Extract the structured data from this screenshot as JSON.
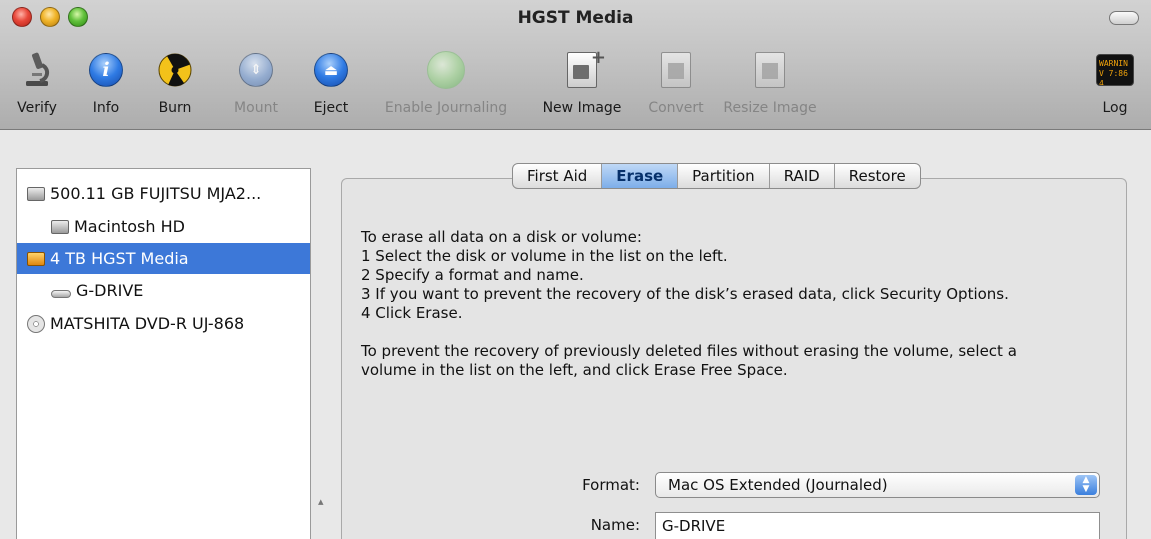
{
  "window": {
    "title": "HGST Media"
  },
  "toolbar": [
    {
      "label": "Verify",
      "icon": "microscope-icon",
      "enabled": true
    },
    {
      "label": "Info",
      "icon": "info-icon",
      "enabled": true
    },
    {
      "label": "Burn",
      "icon": "burn-icon",
      "enabled": true
    },
    {
      "label": "Mount",
      "icon": "mount-icon",
      "enabled": false
    },
    {
      "label": "Eject",
      "icon": "eject-icon",
      "enabled": true
    },
    {
      "label": "Enable Journaling",
      "icon": "journaling-icon",
      "enabled": false
    },
    {
      "label": "New Image",
      "icon": "new-image-icon",
      "enabled": true
    },
    {
      "label": "Convert",
      "icon": "convert-icon",
      "enabled": false
    },
    {
      "label": "Resize Image",
      "icon": "resize-image-icon",
      "enabled": false
    },
    {
      "label": "Log",
      "icon": "log-icon",
      "enabled": true
    }
  ],
  "log_icon_text": [
    "WARNIN",
    "V 7:86 4"
  ],
  "sidebar": {
    "items": [
      {
        "label": "500.11 GB FUJITSU MJA2...",
        "icon": "hard-disk-icon",
        "selected": false
      },
      {
        "label": "Macintosh HD",
        "icon": "volume-icon",
        "selected": false
      },
      {
        "label": "4 TB HGST Media",
        "icon": "external-disk-icon",
        "selected": true
      },
      {
        "label": "G-DRIVE",
        "icon": "volume-icon",
        "selected": false
      },
      {
        "label": "MATSHITA DVD-R UJ-868",
        "icon": "optical-drive-icon",
        "selected": false
      }
    ]
  },
  "tabs": [
    {
      "label": "First Aid",
      "active": false
    },
    {
      "label": "Erase",
      "active": true
    },
    {
      "label": "Partition",
      "active": false
    },
    {
      "label": "RAID",
      "active": false
    },
    {
      "label": "Restore",
      "active": false
    }
  ],
  "erase": {
    "instructions": [
      "To erase all data on a disk or volume:",
      "1 Select the disk or volume in the list on the left.",
      "2 Specify a format and name.",
      "3 If you want to prevent the recovery of the disk’s erased data, click Security Options.",
      "4 Click Erase."
    ],
    "free_space_note": [
      "To prevent the recovery of previously deleted files without erasing the volume, select a",
      "volume in the list on the left, and click Erase Free Space."
    ],
    "format_label": "Format:",
    "format_value": "Mac OS Extended (Journaled)",
    "name_label": "Name:",
    "name_value": "G-DRIVE"
  },
  "colors": {
    "selection": "#3d78d8",
    "active_tab": "#7daee9",
    "window_bg": "#e8e8e8"
  }
}
